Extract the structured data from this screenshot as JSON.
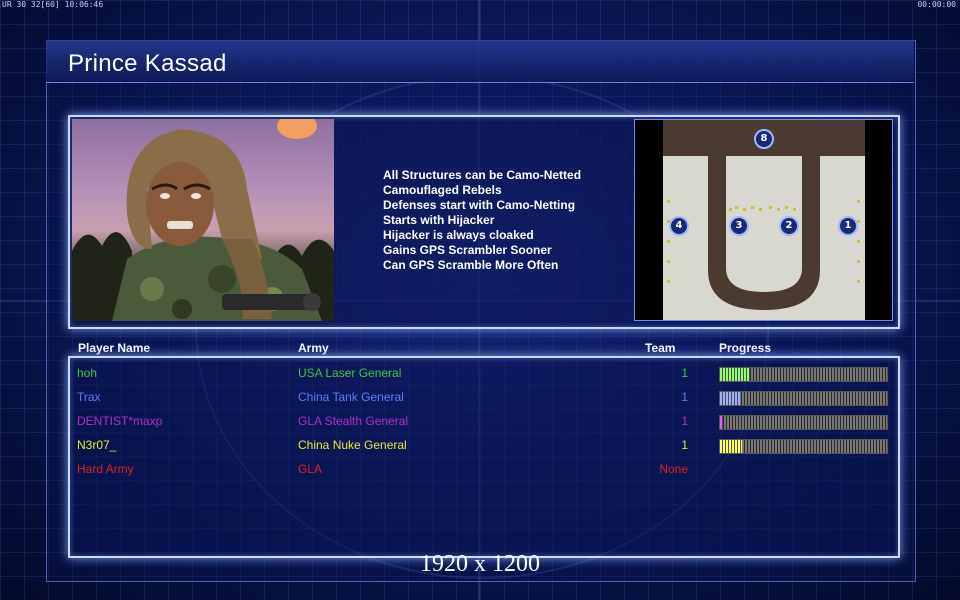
{
  "hud": {
    "left_text": "UR 30 32[60] 10:06:46",
    "right_text": "00:00:00"
  },
  "title": "Prince Kassad",
  "features": [
    "All Structures can be Camo-Netted",
    "Camouflaged Rebels",
    "Defenses start with Camo-Netting",
    "Starts with Hijacker",
    "Hijacker is always cloaked",
    "Gains GPS Scrambler Sooner",
    "Can GPS Scramble More Often"
  ],
  "minimap": {
    "spawns": [
      "8",
      "4",
      "3",
      "2",
      "1"
    ]
  },
  "table": {
    "headers": {
      "player_name": "Player Name",
      "army": "Army",
      "team": "Team",
      "progress": "Progress"
    },
    "rows": [
      {
        "name": "hoh",
        "army": "USA Laser General",
        "team": "1",
        "color": "#3ec83e",
        "progress": 0.18,
        "bar_color": "#8cff6a"
      },
      {
        "name": "Trax",
        "army": "China Tank General",
        "team": "1",
        "color": "#5b7cff",
        "progress": 0.12,
        "bar_color": "#9ab0ff"
      },
      {
        "name": "DENTIST*maxp",
        "army": "GLA Stealth General",
        "team": "1",
        "color": "#b030c8",
        "progress": 0.02,
        "bar_color": "#e060ff"
      },
      {
        "name": "N3r07_",
        "army": "China Nuke General",
        "team": "1",
        "color": "#e8e838",
        "progress": 0.13,
        "bar_color": "#ffff60"
      },
      {
        "name": "Hard Army",
        "army": "GLA",
        "team": "None",
        "color": "#e02020"
      }
    ]
  },
  "resolution_label": "1920 x 1200"
}
